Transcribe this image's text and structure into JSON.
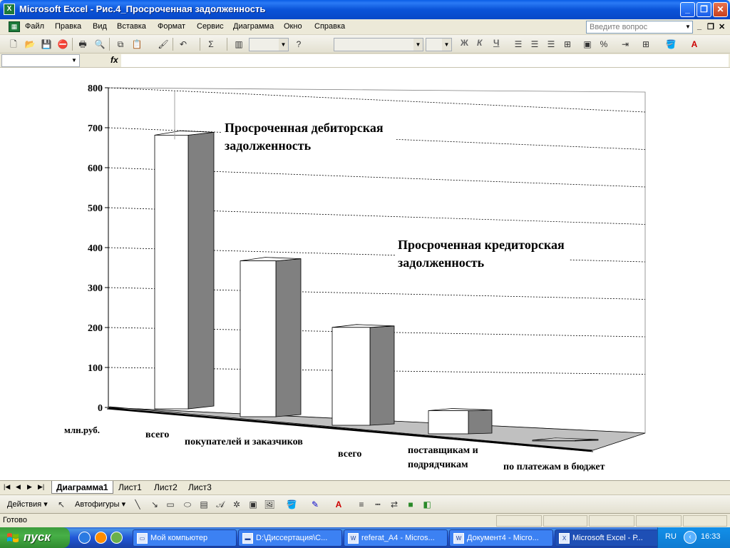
{
  "window": {
    "title": "Microsoft Excel - Рис.4_Просроченная задолженность"
  },
  "menu": {
    "items": [
      "Файл",
      "Правка",
      "Вид",
      "Вставка",
      "Формат",
      "Сервис",
      "Диаграмма",
      "Окно",
      "Справка"
    ],
    "help_placeholder": "Введите вопрос"
  },
  "formula_bar": {
    "fx": "fx"
  },
  "chart_data": {
    "type": "bar",
    "unit_label": "млн.руб.",
    "ylim": [
      0,
      800
    ],
    "yticks": [
      0,
      100,
      200,
      300,
      400,
      500,
      600,
      700,
      800
    ],
    "categories": [
      "всего",
      "покупателей и заказчиков",
      "всего",
      "поставщикам и подрядчикам",
      "по платежам в бюджет"
    ],
    "values": [
      685,
      390,
      245,
      58,
      2
    ],
    "annotations": [
      "Просроченная дебиторская задолженность",
      "Просроченная кредиторская задолженность"
    ],
    "grid": true
  },
  "sheet_tabs": {
    "tabs": [
      "Диаграмма1",
      "Лист1",
      "Лист2",
      "Лист3"
    ],
    "active": "Диаграмма1"
  },
  "drawing_toolbar": {
    "actions_label": "Действия",
    "autoshapes_label": "Автофигуры"
  },
  "status": {
    "text": "Готово"
  },
  "taskbar": {
    "start_label": "пуск",
    "tasks": [
      "Мой компьютер",
      "D:\\Диссертация\\С...",
      "referat_A4 - Micros...",
      "Документ4 - Micro...",
      "Microsoft Excel - Р..."
    ],
    "lang": "RU",
    "clock": "16:33"
  },
  "colors": {
    "bar_front": "#ffffff",
    "bar_side": "#808080",
    "floor": "#c0c0c0",
    "titlebar": "#0a53d8",
    "taskbar": "#2157d7"
  }
}
